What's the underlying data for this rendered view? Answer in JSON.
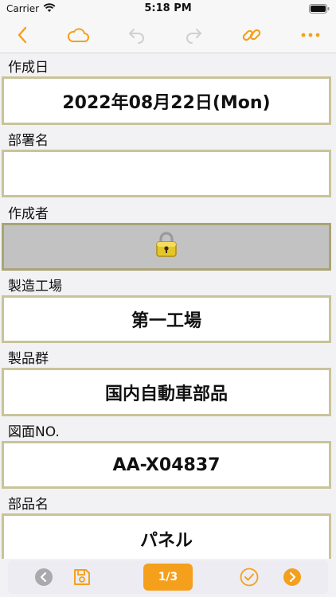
{
  "status_bar": {
    "carrier": "Carrier",
    "time": "5:18 PM"
  },
  "nav_bar": {
    "accent_color": "#f4a01c",
    "icons": [
      "chevron-left-icon",
      "cloud-icon",
      "undo-icon",
      "redo-icon",
      "link-icon",
      "more-icon"
    ]
  },
  "form": {
    "fields": [
      {
        "label": "作成日",
        "value": "2022年08月22日(Mon)",
        "locked": false
      },
      {
        "label": "部署名",
        "value": "",
        "locked": false
      },
      {
        "label": "作成者",
        "value": "",
        "locked": true
      },
      {
        "label": "製造工場",
        "value": "第一工場",
        "locked": false
      },
      {
        "label": "製品群",
        "value": "国内自動車部品",
        "locked": false
      },
      {
        "label": "図面NO.",
        "value": "AA-X04837",
        "locked": false
      },
      {
        "label": "部品名",
        "value": "パネル",
        "locked": false
      }
    ]
  },
  "bottom_bar": {
    "page_indicator": "1/3"
  }
}
